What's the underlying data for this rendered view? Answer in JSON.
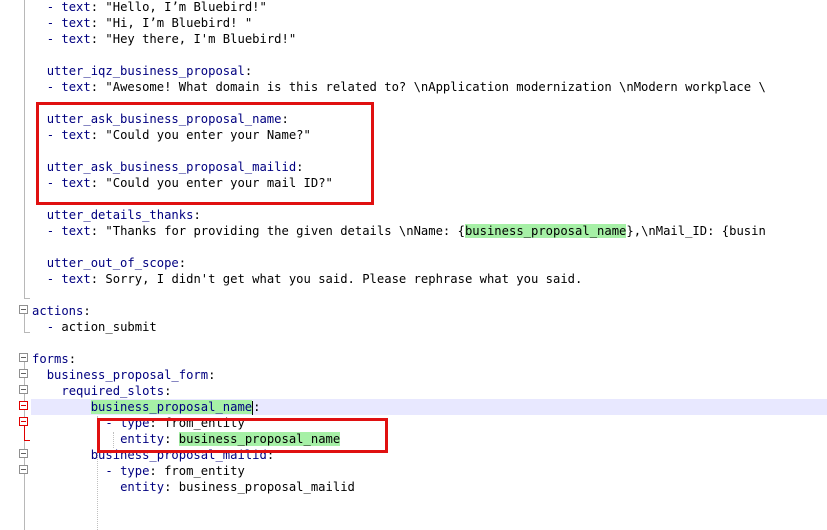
{
  "editor": {
    "lines": [
      {
        "indent": "  ",
        "dash": "- ",
        "key": "text",
        "rest": ": \"Hello, I’m Bluebird!\""
      },
      {
        "indent": "  ",
        "dash": "- ",
        "key": "text",
        "rest": ": \"Hi, I’m Bluebird! \""
      },
      {
        "indent": "  ",
        "dash": "- ",
        "key": "text",
        "rest": ": \"Hey there, I'm Bluebird!\""
      },
      {
        "indent": "",
        "dash": "",
        "key": "",
        "rest": ""
      },
      {
        "indent": "  ",
        "dash": "",
        "key": "utter_iqz_business_proposal",
        "rest": ":"
      },
      {
        "indent": "  ",
        "dash": "- ",
        "key": "text",
        "rest": ": \"Awesome! What domain is this related to? \\nApplication modernization \\nModern workplace \\"
      },
      {
        "indent": "",
        "dash": "",
        "key": "",
        "rest": ""
      },
      {
        "indent": "  ",
        "dash": "",
        "key": "utter_ask_business_proposal_name",
        "rest": ":"
      },
      {
        "indent": "  ",
        "dash": "- ",
        "key": "text",
        "rest": ": \"Could you enter your Name?\""
      },
      {
        "indent": "",
        "dash": "",
        "key": "",
        "rest": ""
      },
      {
        "indent": "  ",
        "dash": "",
        "key": "utter_ask_business_proposal_mailid",
        "rest": ":"
      },
      {
        "indent": "  ",
        "dash": "- ",
        "key": "text",
        "rest": ": \"Could you enter your mail ID?\""
      },
      {
        "indent": "",
        "dash": "",
        "key": "",
        "rest": ""
      },
      {
        "indent": "  ",
        "dash": "",
        "key": "utter_details_thanks",
        "rest": ":"
      },
      {
        "indent": "  ",
        "dash": "- ",
        "key": "text",
        "rest": ": \"Thanks for providing the given details \\nName: {",
        "hl": "business_proposal_name",
        "after": "},\\nMail_ID: {busin"
      },
      {
        "indent": "",
        "dash": "",
        "key": "",
        "rest": ""
      },
      {
        "indent": "  ",
        "dash": "",
        "key": "utter_out_of_scope",
        "rest": ":"
      },
      {
        "indent": "  ",
        "dash": "- ",
        "key": "text",
        "rest": ": Sorry, I didn't get what you said. Please rephrase what you said."
      },
      {
        "indent": "",
        "dash": "",
        "key": "",
        "rest": ""
      },
      {
        "indent": "",
        "dash": "",
        "key": "actions",
        "rest": ":"
      },
      {
        "indent": "  ",
        "dash": "- ",
        "key": "",
        "rest": "action_submit"
      },
      {
        "indent": "",
        "dash": "",
        "key": "",
        "rest": ""
      },
      {
        "indent": "",
        "dash": "",
        "key": "forms",
        "rest": ":"
      },
      {
        "indent": "  ",
        "dash": "",
        "key": "business_proposal_form",
        "rest": ":"
      },
      {
        "indent": "    ",
        "dash": "",
        "key": "required_slots",
        "rest": ":"
      },
      {
        "indent": "        ",
        "dash": "",
        "key": "",
        "hl": "business_proposal_name",
        "rest": ":",
        "current": true
      },
      {
        "indent": "          ",
        "dash": "- ",
        "key": "type",
        "rest": ": from_entity"
      },
      {
        "indent": "            ",
        "dash": "",
        "key": "entity",
        "rest": ": ",
        "hl": "business_proposal_name"
      },
      {
        "indent": "        ",
        "dash": "",
        "key": "business_proposal_mailid",
        "rest": ":"
      },
      {
        "indent": "          ",
        "dash": "- ",
        "key": "type",
        "rest": ": from_entity"
      },
      {
        "indent": "            ",
        "dash": "",
        "key": "entity",
        "rest": ": business_proposal_mailid"
      }
    ]
  }
}
